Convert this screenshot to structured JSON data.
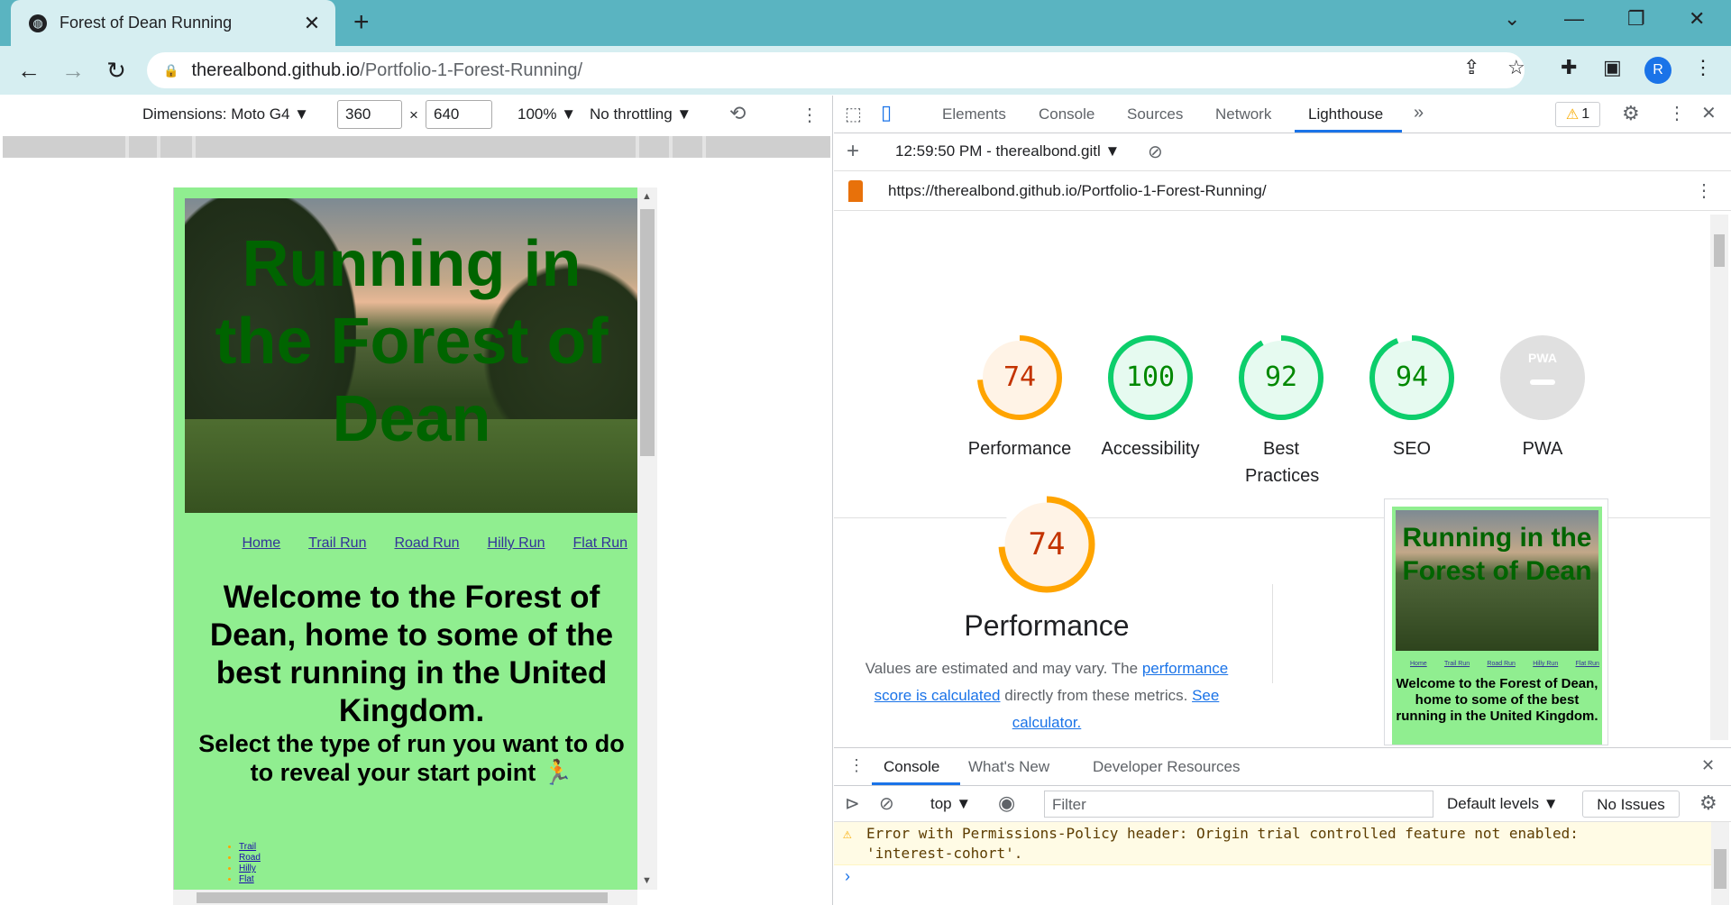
{
  "browser": {
    "tab_title": "Forest of Dean Running",
    "tab_close": "✕",
    "new_tab": "+",
    "url_host": "therealbond.github.io",
    "url_path": "/Portfolio-1-Forest-Running/",
    "profile_initial": "R",
    "window_controls": [
      "⌄",
      "—",
      "❐",
      "✕"
    ]
  },
  "device_toolbar": {
    "dimensions_label": "Dimensions: Moto G4 ▼",
    "width": "360",
    "times": "×",
    "height": "640",
    "zoom": "100% ▼",
    "throttling": "No throttling ▼"
  },
  "site": {
    "hero_title": "Running in the Forest of Dean",
    "nav": [
      "Home",
      "Trail Run",
      "Road Run",
      "Hilly Run",
      "Flat Run"
    ],
    "welcome": "Welcome to the Forest of Dean, home to some of the best running in the United Kingdom.",
    "select": "Select the type of run you want to do to reveal your start point 🏃",
    "run_list": [
      "Trail",
      "Road",
      "Hilly",
      "Flat"
    ]
  },
  "devtools": {
    "tabs": [
      "Elements",
      "Console",
      "Sources",
      "Network",
      "Lighthouse",
      "»"
    ],
    "active_tab": "Lighthouse",
    "warning_count": "1",
    "lh_report_label": "12:59:50 PM - therealbond.gitl ▼",
    "lh_url": "https://therealbond.github.io/Portfolio-1-Forest-Running/",
    "scores": [
      {
        "label": "Performance",
        "value": "74",
        "score": 74,
        "color": "#ffa400",
        "text_color": "#c33300",
        "fill": "#fff3e6"
      },
      {
        "label": "Accessibility",
        "value": "100",
        "score": 100,
        "color": "#0cce6b",
        "text_color": "#008800",
        "fill": "#e6faf0"
      },
      {
        "label": "Best Practices",
        "value": "92",
        "score": 92,
        "color": "#0cce6b",
        "text_color": "#008800",
        "fill": "#e6faf0"
      },
      {
        "label": "SEO",
        "value": "94",
        "score": 94,
        "color": "#0cce6b",
        "text_color": "#008800",
        "fill": "#e6faf0"
      },
      {
        "label": "PWA",
        "value": "PWA",
        "score": 0,
        "color": "#cccccc",
        "text_color": "#ffffff",
        "fill": "#e0e0e0"
      }
    ],
    "perf": {
      "value": "74",
      "title": "Performance",
      "desc_prefix": "Values are estimated and may vary. The ",
      "link1": "performance score is calculated",
      "desc_mid": " directly from these metrics. ",
      "link2": "See calculator.",
      "thumb_title": "Running in the Forest of Dean",
      "thumb_welcome": "Welcome to the Forest of Dean, home to some of the best running in the United Kingdom.",
      "thumb_nav": [
        "Home",
        "Trail Run",
        "Road Run",
        "Hilly Run",
        "Flat Run"
      ]
    }
  },
  "drawer": {
    "tabs": [
      "Console",
      "What's New",
      "Developer Resources"
    ],
    "context": "top ▼",
    "filter_placeholder": "Filter",
    "levels": "Default levels ▼",
    "issues": "No Issues",
    "message_line1": "Error with Permissions-Policy header: Origin trial controlled feature not enabled:",
    "message_line2": "'interest-cohort'.",
    "prompt": "›"
  }
}
